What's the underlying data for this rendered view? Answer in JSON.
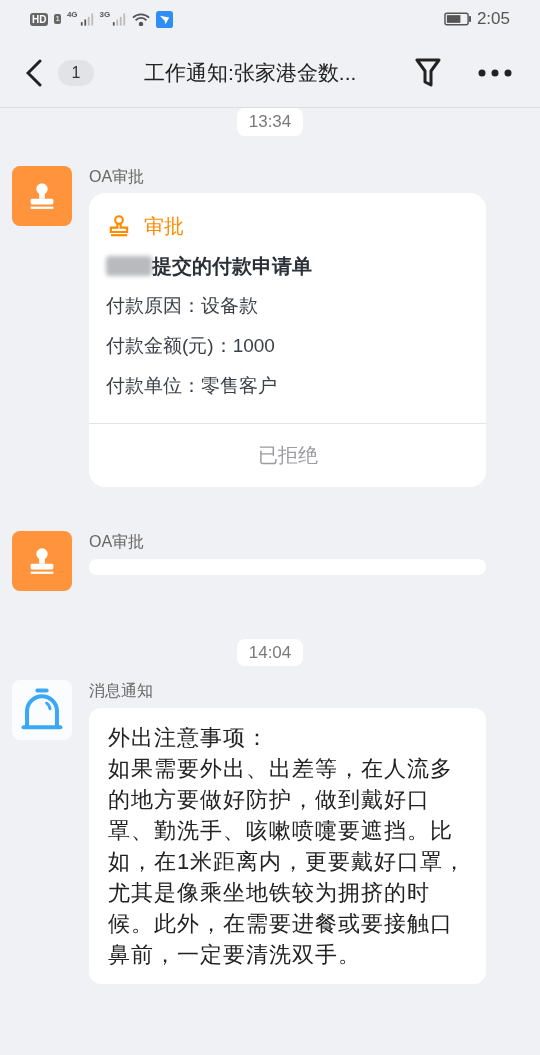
{
  "status_bar": {
    "hd": "HD",
    "hd_sub": "1",
    "net1": "4G",
    "net2": "3G",
    "time": "2:05"
  },
  "header": {
    "back_count": "1",
    "title": "工作通知:张家港金数..."
  },
  "messages": [
    {
      "kind": "timestamp",
      "text": "13:34"
    },
    {
      "kind": "approval",
      "sender": "OA审批",
      "card": {
        "tag": "审批",
        "title": "提交的付款申请单",
        "redacted": true,
        "fields": [
          {
            "label": "付款原因：",
            "value": "设备款"
          },
          {
            "label": "付款金额(元)：",
            "value": "1000"
          },
          {
            "label": "付款单位：",
            "value": "零售客户"
          }
        ],
        "status": "已拒绝"
      }
    },
    {
      "kind": "approval_empty",
      "sender": "OA审批"
    },
    {
      "kind": "timestamp",
      "text": "14:04"
    },
    {
      "kind": "notice",
      "sender": "消息通知",
      "heading": "外出注意事项：",
      "body": "如果需要外出、出差等，在人流多的地方要做好防护，做到戴好口罩、勤洗手、咳嗽喷嚏要遮挡。比如，在1米距离内，更要戴好口罩，尤其是像乘坐地铁较为拥挤的时候。此外，在需要进餐或要接触口鼻前，一定要清洗双手。"
    }
  ]
}
